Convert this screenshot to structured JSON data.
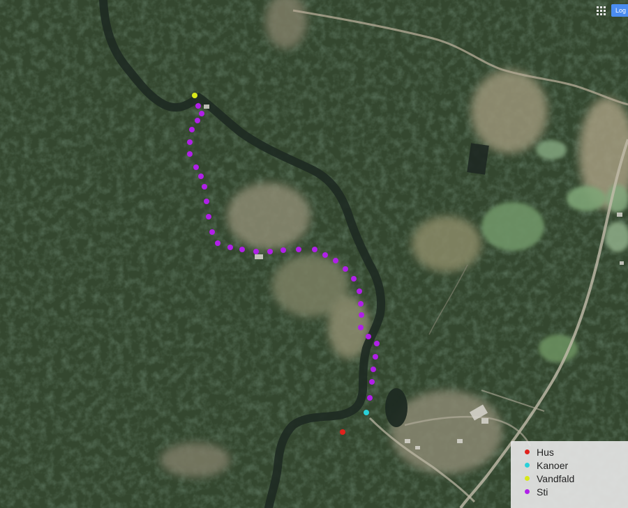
{
  "header": {
    "apps_icon": "apps-grid-icon",
    "login_label": "Log in"
  },
  "legend": {
    "items": [
      {
        "label": "Hus",
        "color": "#e0221c"
      },
      {
        "label": "Kanoer",
        "color": "#2ad0d8"
      },
      {
        "label": "Vandfald",
        "color": "#d8e81a"
      },
      {
        "label": "Sti",
        "color": "#b020e8"
      }
    ]
  },
  "markers": {
    "hus_color": "#e0221c",
    "kanoer_color": "#2ad0d8",
    "vandfald_color": "#d8e81a",
    "sti_color": "#b020e8"
  }
}
